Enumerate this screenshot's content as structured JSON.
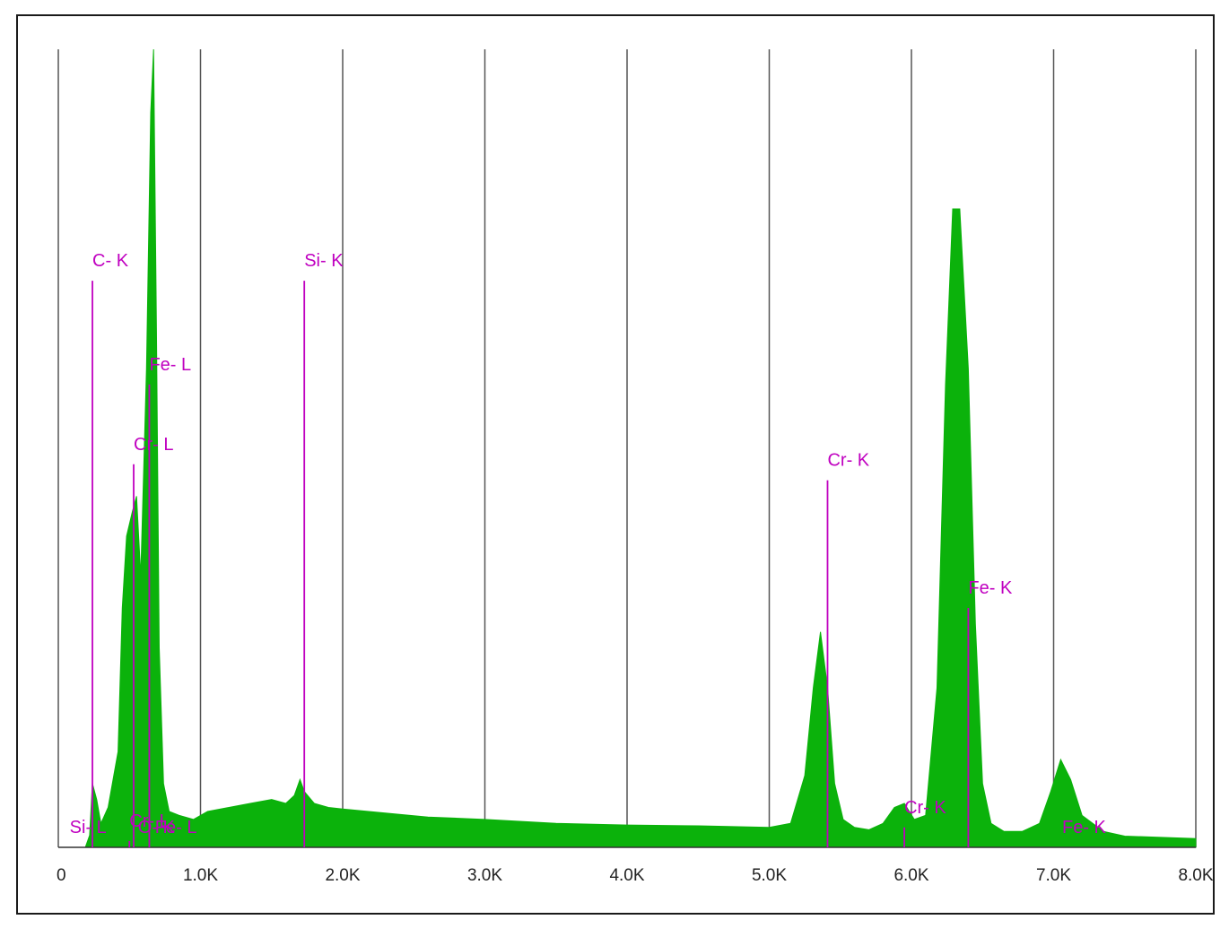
{
  "chart_data": {
    "type": "area",
    "xlim": [
      0,
      8.0
    ],
    "ylim": [
      0,
      1
    ],
    "x_ticks": [
      {
        "value": 0,
        "label": "0"
      },
      {
        "value": 1.0,
        "label": "1.0K"
      },
      {
        "value": 2.0,
        "label": "2.0K"
      },
      {
        "value": 3.0,
        "label": "3.0K"
      },
      {
        "value": 4.0,
        "label": "4.0K"
      },
      {
        "value": 5.0,
        "label": "5.0K"
      },
      {
        "value": 6.0,
        "label": "6.0K"
      },
      {
        "value": 7.0,
        "label": "7.0K"
      },
      {
        "value": 8.0,
        "label": "8.0K"
      }
    ],
    "grid": true,
    "series": [
      {
        "color": "#0bb20b",
        "x": [
          0.0,
          0.19,
          0.22,
          0.24,
          0.27,
          0.3,
          0.35,
          0.42,
          0.45,
          0.48,
          0.52,
          0.55,
          0.58,
          0.62,
          0.65,
          0.67,
          0.69,
          0.71,
          0.74,
          0.78,
          0.85,
          0.95,
          1.05,
          1.2,
          1.35,
          1.5,
          1.6,
          1.66,
          1.7,
          1.73,
          1.8,
          1.9,
          2.0,
          2.3,
          2.6,
          3.0,
          3.5,
          4.0,
          4.5,
          5.0,
          5.15,
          5.25,
          5.31,
          5.36,
          5.41,
          5.46,
          5.52,
          5.6,
          5.7,
          5.8,
          5.88,
          5.95,
          6.02,
          6.1,
          6.18,
          6.24,
          6.29,
          6.34,
          6.4,
          6.45,
          6.5,
          6.56,
          6.65,
          6.78,
          6.9,
          6.98,
          7.05,
          7.12,
          7.2,
          7.35,
          7.5,
          8.0
        ],
        "y": [
          0.0,
          0.0,
          0.015,
          0.08,
          0.06,
          0.03,
          0.05,
          0.12,
          0.3,
          0.39,
          0.42,
          0.44,
          0.34,
          0.6,
          0.92,
          1.0,
          0.65,
          0.25,
          0.08,
          0.045,
          0.04,
          0.035,
          0.045,
          0.05,
          0.055,
          0.06,
          0.055,
          0.065,
          0.085,
          0.07,
          0.055,
          0.05,
          0.048,
          0.043,
          0.038,
          0.035,
          0.03,
          0.028,
          0.027,
          0.025,
          0.03,
          0.09,
          0.2,
          0.27,
          0.2,
          0.08,
          0.035,
          0.025,
          0.022,
          0.03,
          0.05,
          0.055,
          0.035,
          0.04,
          0.2,
          0.58,
          0.8,
          0.8,
          0.6,
          0.28,
          0.08,
          0.03,
          0.02,
          0.02,
          0.03,
          0.07,
          0.11,
          0.085,
          0.04,
          0.02,
          0.014,
          0.011
        ]
      }
    ],
    "peak_markers": [
      {
        "label": "Si- L",
        "x": 0.08,
        "line_top": 0.0
      },
      {
        "label": "C- K",
        "x": 0.24,
        "line_top": 0.71
      },
      {
        "label": "Cr- L",
        "x": 0.5,
        "line_top": 0.008
      },
      {
        "label": "Cr- L",
        "x": 0.53,
        "line_top": 0.48
      },
      {
        "label": "O- K",
        "x": 0.56,
        "line_top": 0.0
      },
      {
        "label": "Fe- L",
        "x": 0.64,
        "line_top": 0.58
      },
      {
        "label": "Fe- L",
        "x": 0.68,
        "line_top": 0.0
      },
      {
        "label": "Si- K",
        "x": 1.73,
        "line_top": 0.71
      },
      {
        "label": "Cr- K",
        "x": 5.41,
        "line_top": 0.46
      },
      {
        "label": "Cr- K",
        "x": 5.95,
        "line_top": 0.025
      },
      {
        "label": "Fe- K",
        "x": 6.4,
        "line_top": 0.3
      },
      {
        "label": "Fe- K",
        "x": 7.06,
        "line_top": 0.0
      }
    ],
    "marker_color": "#c000c0"
  }
}
